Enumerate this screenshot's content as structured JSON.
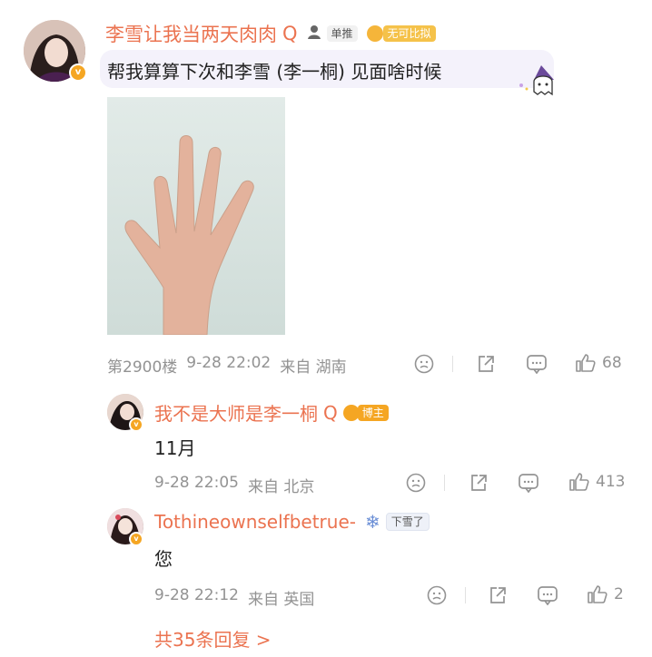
{
  "main_comment": {
    "username": "李雪让我当两天肉肉",
    "fan_badge": "单推",
    "medal": "无可比拟",
    "text": "帮我算算下次和李雪 (李一桐) 见面啥时候",
    "floor": "第2900楼",
    "time": "9-28 22:02",
    "source": "来自 湖南",
    "likes": "68"
  },
  "replies": [
    {
      "username": "我不是大师是李一桐",
      "badge": "博主",
      "text": "11月",
      "time": "9-28 22:05",
      "source": "来自 北京",
      "likes": "413"
    },
    {
      "username": "Tothineownselfbetrue-",
      "badge": "下雪了",
      "text": "您",
      "time": "9-28 22:12",
      "source": "来自 英国",
      "likes": "2"
    }
  ],
  "more_replies": "共35条回复 >",
  "colors": {
    "accent": "#eb7350",
    "meta": "#939393",
    "gold": "#f5a623"
  }
}
